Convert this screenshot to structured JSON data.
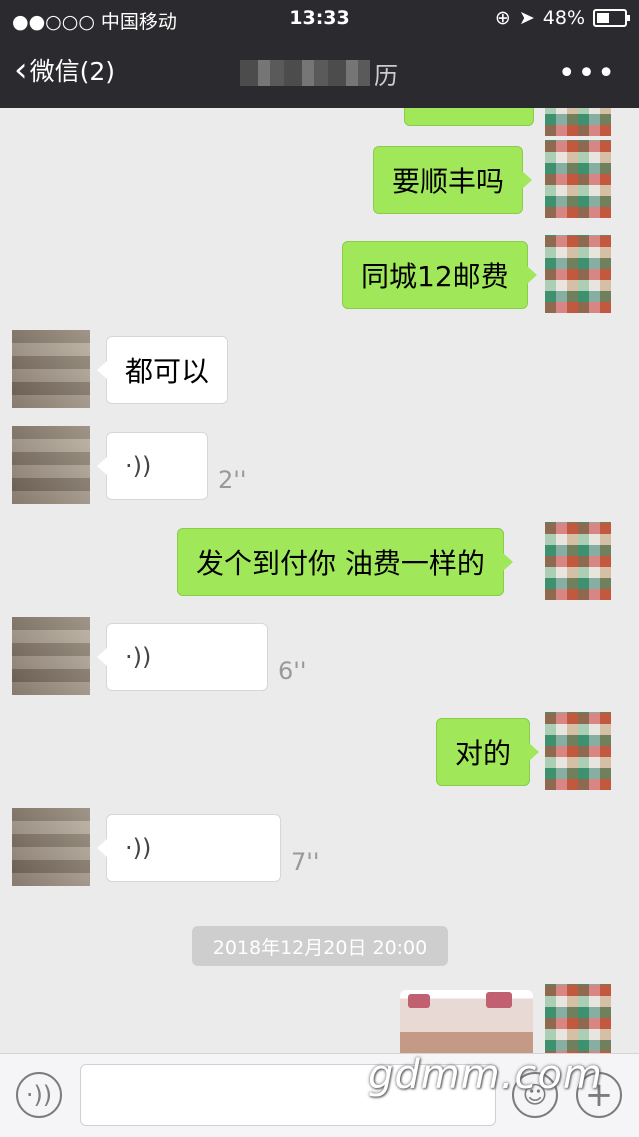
{
  "status_bar": {
    "carrier": "●●○○○ 中国移动",
    "time": "13:33",
    "battery": "48%"
  },
  "nav": {
    "back_label": "微信(2)",
    "title_suffix": "历",
    "more_label": "•••"
  },
  "messages": [
    {
      "side": "right",
      "type": "text",
      "text": "要顺丰吗"
    },
    {
      "side": "right",
      "type": "text",
      "text": "同城12邮费"
    },
    {
      "side": "left",
      "type": "text",
      "text": "都可以"
    },
    {
      "side": "left",
      "type": "voice",
      "duration": "2''"
    },
    {
      "side": "right",
      "type": "text",
      "text": "发个到付你 油费一样的"
    },
    {
      "side": "left",
      "type": "voice",
      "duration": "6''"
    },
    {
      "side": "right",
      "type": "text",
      "text": "对的"
    },
    {
      "side": "left",
      "type": "voice",
      "duration": "7''"
    },
    {
      "side": "right",
      "type": "image"
    }
  ],
  "timestamp": "2018年12月20日 20:00",
  "input_bar": {
    "voice_icon": "voice-icon",
    "emoji_icon": "emoji-icon",
    "plus_icon": "plus-icon"
  },
  "watermark": "gdmm.com",
  "colors": {
    "nav_bg": "#2b2b2f",
    "chat_bg": "#ebebeb",
    "outgoing_bubble": "#a0e75a",
    "incoming_bubble": "#ffffff"
  }
}
